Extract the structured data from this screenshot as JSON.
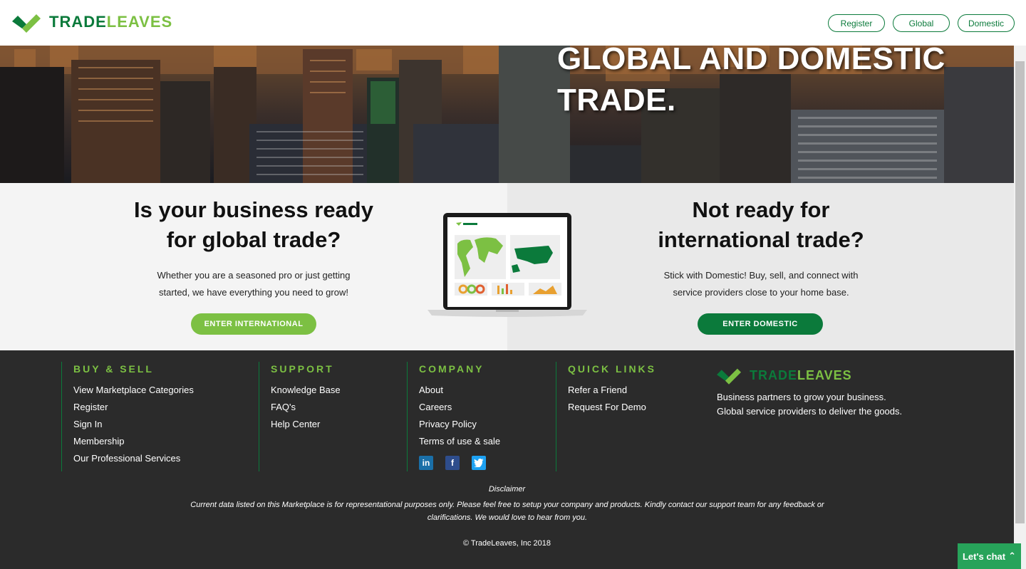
{
  "brand": {
    "name_part1": "TRADE",
    "name_part2": "LEAVES",
    "color_dark": "#0b7a3b",
    "color_light": "#7cc043"
  },
  "header": {
    "nav": [
      "Register",
      "Global",
      "Domestic"
    ]
  },
  "hero": {
    "title_line1": "GLOBAL AND DOMESTIC",
    "title_line2": "TRADE."
  },
  "international": {
    "heading_line1": "Is your business ready",
    "heading_line2": "for global trade?",
    "text_line1": "Whether you are a seasoned pro or just getting",
    "text_line2": "started, we have everything you need to grow!",
    "button": "ENTER INTERNATIONAL"
  },
  "domestic": {
    "heading_line1": "Not ready for",
    "heading_line2": "international trade?",
    "text_line1": "Stick with Domestic! Buy, sell, and connect with",
    "text_line2": "service providers close to your home base.",
    "button": "ENTER DOMESTIC"
  },
  "footer": {
    "buy_sell": {
      "title": "BUY & SELL",
      "links": [
        "View Marketplace Categories",
        "Register",
        "Sign In",
        "Membership",
        "Our Professional Services"
      ]
    },
    "support": {
      "title": "SUPPORT",
      "links": [
        "Knowledge Base",
        "FAQ's",
        "Help Center"
      ]
    },
    "company": {
      "title": "COMPANY",
      "links": [
        "About",
        "Careers",
        "Privacy Policy",
        "Terms of use & sale"
      ],
      "social_icons": [
        "linkedin-icon",
        "facebook-icon",
        "twitter-icon"
      ]
    },
    "quick_links": {
      "title": "QUICK LINKS",
      "links": [
        "Refer a Friend",
        "Request For Demo"
      ]
    },
    "tagline_line1": "Business partners to grow your business.",
    "tagline_line2": "Global service providers to deliver the goods.",
    "disclaimer_title": "Disclaimer",
    "disclaimer_text": "Current data listed on this Marketplace is for representational purposes only. Please feel free to setup your company and products. Kindly contact our support team for any feedback or clarifications. We would love to hear from you.",
    "copyright": "© TradeLeaves, Inc 2018"
  },
  "chat": {
    "label": "Let's chat"
  }
}
